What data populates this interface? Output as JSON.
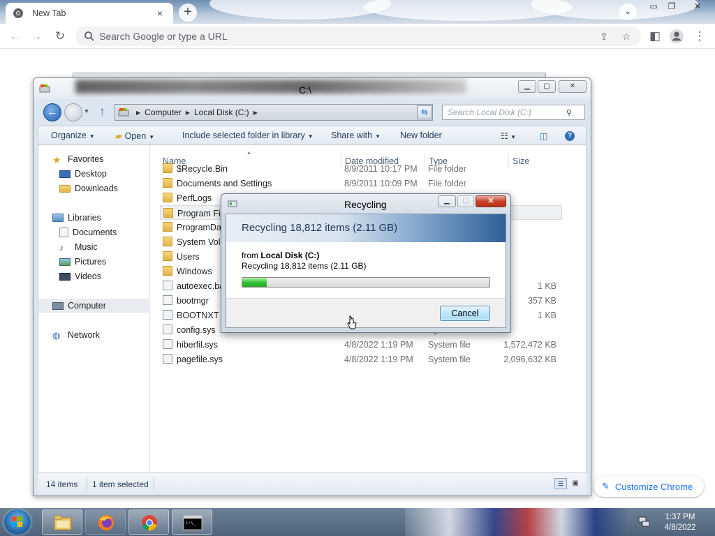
{
  "chrome": {
    "tab_title": "New Tab",
    "tab_close": "×",
    "new_tab": "+",
    "omnibox_placeholder": "Search Google or type a URL",
    "customize_label": "Customize Chrome"
  },
  "explorer": {
    "title": "C:\\",
    "breadcrumb": [
      "Computer",
      "Local Disk (C:)"
    ],
    "search_placeholder": "Search Local Disk (C:)",
    "commands": {
      "organize": "Organize",
      "open": "Open",
      "include": "Include selected folder in library",
      "share": "Share with",
      "new_folder": "New folder"
    },
    "nav": {
      "favorites": "Favorites",
      "desktop": "Desktop",
      "downloads": "Downloads",
      "libraries": "Libraries",
      "documents": "Documents",
      "music": "Music",
      "pictures": "Pictures",
      "videos": "Videos",
      "computer": "Computer",
      "network": "Network"
    },
    "columns": {
      "name": "Name",
      "date": "Date modified",
      "type": "Type",
      "size": "Size"
    },
    "files": [
      {
        "name": "$Recycle.Bin",
        "date": "8/9/2011 10:17 PM",
        "type": "File folder",
        "size": "",
        "icon": "folder-icon"
      },
      {
        "name": "Documents and Settings",
        "date": "8/9/2011 10:09 PM",
        "type": "File folder",
        "size": "",
        "icon": "shortcut-folder-icon"
      },
      {
        "name": "PerfLogs",
        "date": "",
        "type": "",
        "size": "",
        "icon": "folder-icon"
      },
      {
        "name": "Program Files",
        "date": "",
        "type": "",
        "size": "",
        "icon": "folder-icon"
      },
      {
        "name": "ProgramData",
        "date": "",
        "type": "",
        "size": "",
        "icon": "folder-icon"
      },
      {
        "name": "System Volume Information",
        "date": "",
        "type": "",
        "size": "",
        "icon": "folder-icon"
      },
      {
        "name": "Users",
        "date": "",
        "type": "",
        "size": "",
        "icon": "folder-icon"
      },
      {
        "name": "Windows",
        "date": "",
        "type": "",
        "size": "",
        "icon": "folder-icon"
      },
      {
        "name": "autoexec.bat",
        "date": "",
        "type": "",
        "size": "1 KB",
        "icon": "system-file-icon"
      },
      {
        "name": "bootmgr",
        "date": "",
        "type": "",
        "size": "357 KB",
        "icon": "system-file-icon"
      },
      {
        "name": "BOOTNXT",
        "date": "",
        "type": "",
        "size": "1 KB",
        "icon": "system-file-icon"
      },
      {
        "name": "config.sys",
        "date": "8/9/2011 10:53 PM",
        "type": "System file",
        "size": "",
        "icon": "system-file-icon"
      },
      {
        "name": "hiberfil.sys",
        "date": "4/8/2022 1:19 PM",
        "type": "System file",
        "size": "1,572,472 KB",
        "icon": "system-file-icon"
      },
      {
        "name": "pagefile.sys",
        "date": "4/8/2022 1:19 PM",
        "type": "System file",
        "size": "2,096,632 KB",
        "icon": "system-file-icon"
      }
    ],
    "status": {
      "count": "14 items",
      "selected": "1 item selected"
    }
  },
  "dialog": {
    "title": "Recycling",
    "banner": "Recycling 18,812 items (2.11 GB)",
    "from_prefix": "from",
    "from_location": "Local Disk (C:)",
    "detail": "Recycling 18,812 items (2.11 GB)",
    "progress": 0.1,
    "cancel": "Cancel",
    "close": "✕"
  },
  "taskbar": {
    "time": "1:37 PM",
    "date": "4/8/2022"
  },
  "colors": {
    "explorer_frame": "#dce6f1",
    "progress_green": "#34c437",
    "accent_blue": "#1a73e8"
  }
}
